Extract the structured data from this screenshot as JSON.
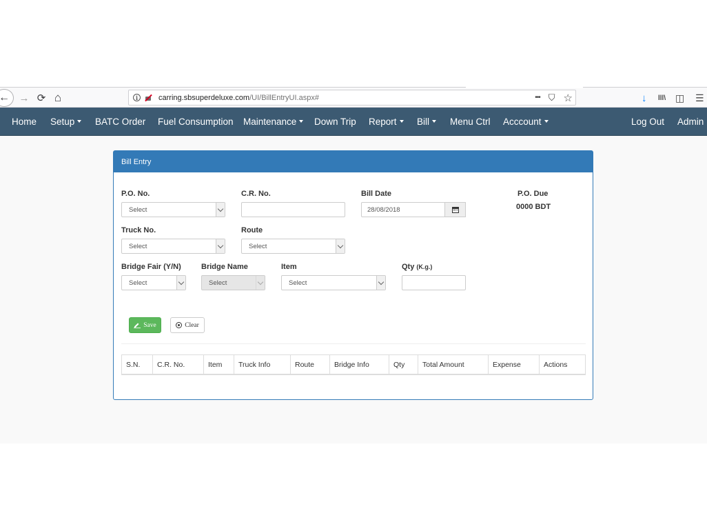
{
  "browser": {
    "url_host": "carring.sbsuperdeluxe.com",
    "url_path": "/UI/BillEntryUI.aspx#",
    "back_glyph": "←",
    "forward_glyph": "→",
    "reload_glyph": "⟳",
    "home_glyph": "⌂",
    "more_glyph": "•••",
    "pocket_glyph": "⛉",
    "star_glyph": "☆",
    "download_glyph": "↓",
    "library_glyph": "lll\\",
    "sidebar_glyph": "◫",
    "menu_glyph": "☰"
  },
  "navbar": {
    "home": "Home",
    "setup": "Setup",
    "batc_order": "BATC Order",
    "fuel_consumption": "Fuel Consumption",
    "maintenance": "Maintenance",
    "down_trip": "Down Trip",
    "report": "Report",
    "bill": "Bill",
    "menu_ctrl": "Menu Ctrl",
    "account": "Acccount",
    "log_out": "Log Out",
    "user": "Admin"
  },
  "panel": {
    "title": "Bill Entry"
  },
  "form": {
    "po_no_label": "P.O. No.",
    "po_no_value": "Select",
    "cr_no_label": "C.R. No.",
    "cr_no_value": "",
    "bill_date_label": "Bill Date",
    "bill_date_value": "28/08/2018",
    "po_due_label": "P.O. Due",
    "po_due_value": "0000 BDT",
    "truck_no_label": "Truck No.",
    "truck_no_value": "Select",
    "route_label": "Route",
    "route_value": "Select",
    "bridge_fair_label": "Bridge Fair (Y/N)",
    "bridge_fair_value": "Select",
    "bridge_name_label": "Bridge Name",
    "bridge_name_value": "Select",
    "item_label": "Item",
    "item_value": "Select",
    "qty_label": "Qty",
    "qty_unit": "(K.g.)",
    "qty_value": ""
  },
  "buttons": {
    "save": "Save",
    "clear": "Clear"
  },
  "table": {
    "headers": [
      "S.N.",
      "C.R. No.",
      "Item",
      "Truck Info",
      "Route",
      "Bridge Info",
      "Qty",
      "Total Amount",
      "Expense",
      "Actions"
    ]
  }
}
